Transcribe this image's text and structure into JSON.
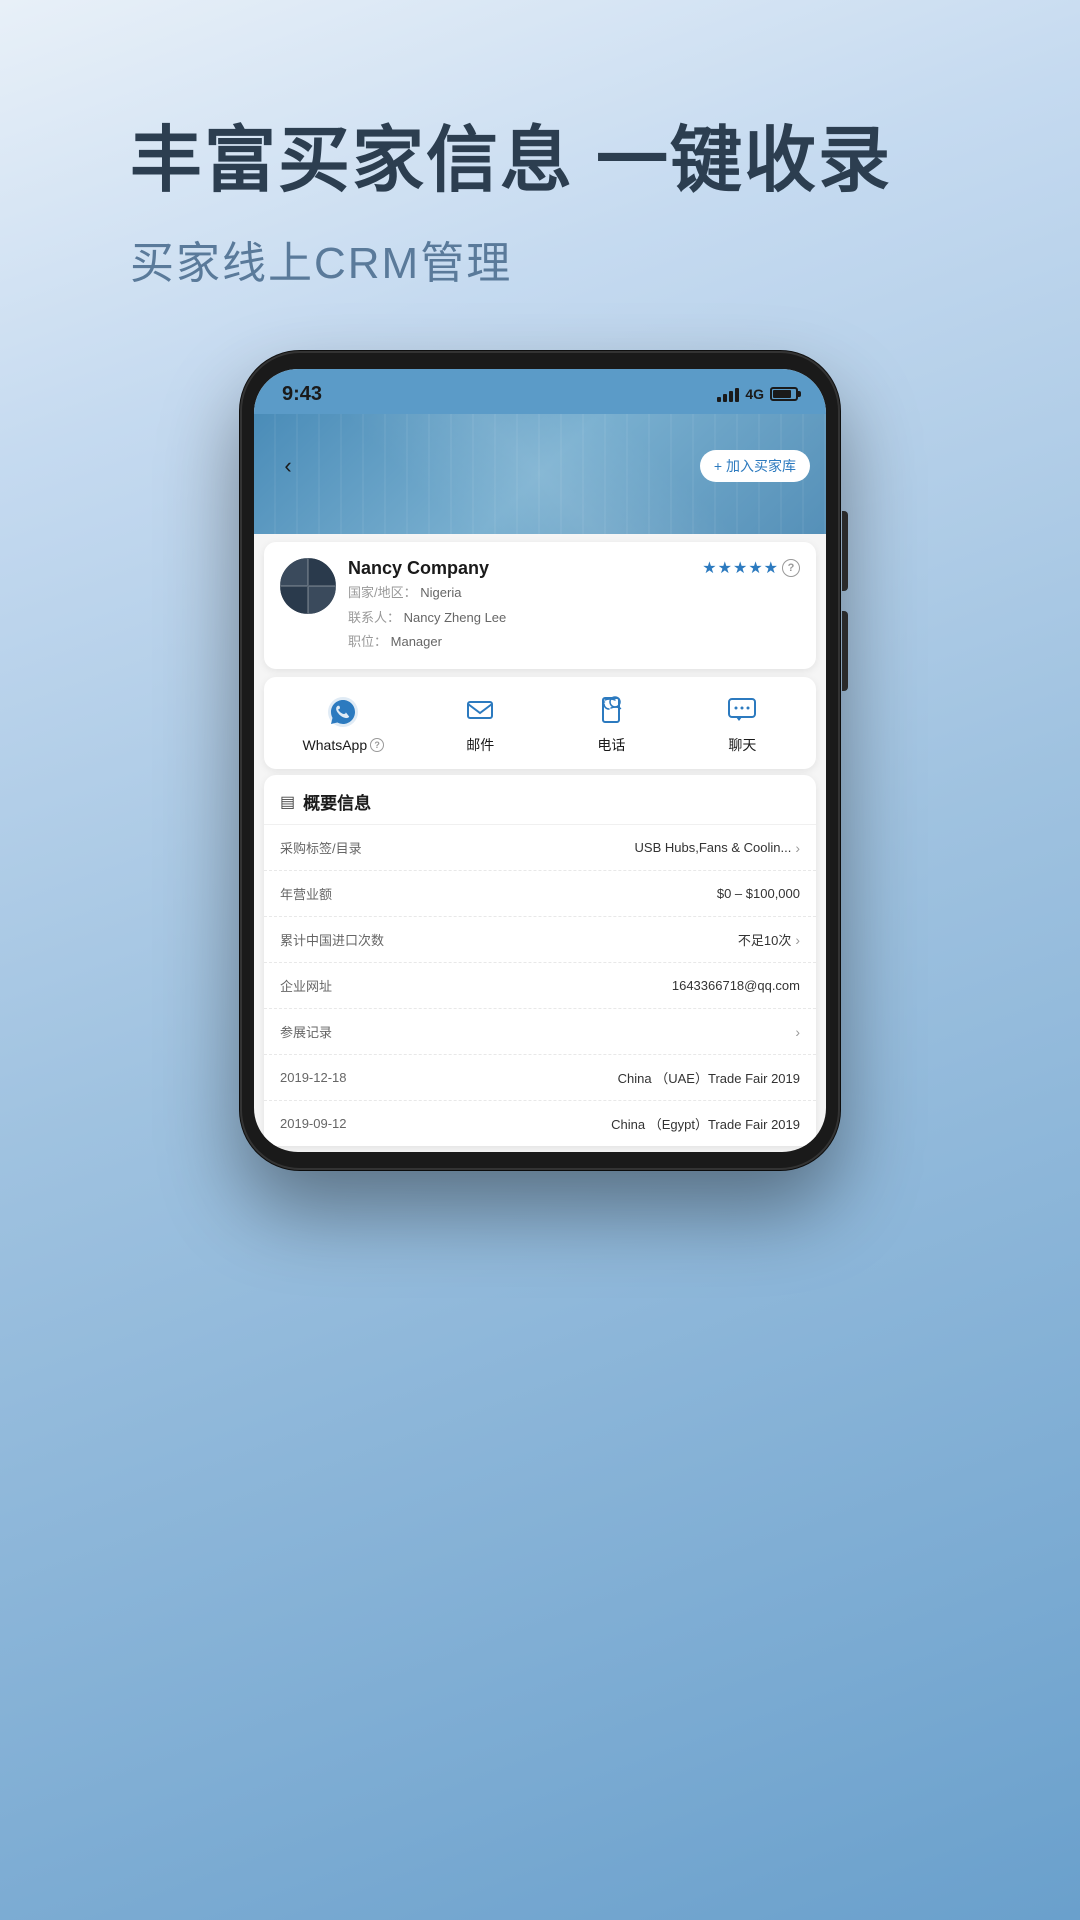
{
  "page": {
    "headline": "丰富买家信息 一键收录",
    "subtitle": "买家线上CRM管理"
  },
  "phone": {
    "status_bar": {
      "time": "9:43",
      "signal": "4G"
    },
    "nav": {
      "back_label": "‹",
      "add_button": "+ 加入买家库"
    },
    "contact": {
      "company": "Nancy Company",
      "country_label": "国家/地区：",
      "country": "Nigeria",
      "contact_person_label": "联系人：",
      "contact_person": "Nancy Zheng Lee",
      "position_label": "职位：",
      "position": "Manager",
      "rating_stars": 5
    },
    "actions": [
      {
        "id": "whatsapp",
        "label": "WhatsApp",
        "has_help": true
      },
      {
        "id": "mail",
        "label": "邮件",
        "has_help": false
      },
      {
        "id": "phone",
        "label": "电话",
        "has_help": false
      },
      {
        "id": "chat",
        "label": "聊天",
        "has_help": false
      }
    ],
    "info_section": {
      "title": "概要信息",
      "rows": [
        {
          "id": "purchase-tag",
          "label": "采购标签/目录",
          "value": "USB Hubs,Fans & Coolin...",
          "has_chevron": true
        },
        {
          "id": "annual-revenue",
          "label": "年营业额",
          "value": "$0 – $100,000",
          "has_chevron": false
        },
        {
          "id": "import-count",
          "label": "累计中国进口次数",
          "value": "不足10次",
          "has_chevron": true
        },
        {
          "id": "website",
          "label": "企业网址",
          "value": "1643366718@qq.com",
          "has_chevron": false
        },
        {
          "id": "exhibition",
          "label": "参展记录",
          "value": "",
          "has_chevron": true
        },
        {
          "id": "trade-2019-1",
          "label": "2019-12-18",
          "value": "China （UAE）Trade Fair 2019",
          "has_chevron": false
        },
        {
          "id": "trade-2019-2",
          "label": "2019-09-12",
          "value": "China （Egypt）Trade Fair 2019",
          "has_chevron": false
        }
      ]
    }
  }
}
